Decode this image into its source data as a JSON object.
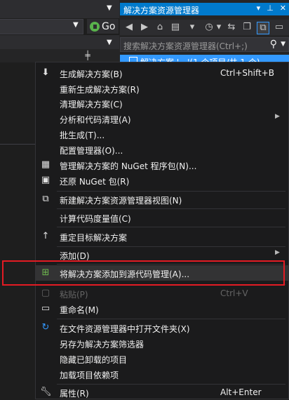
{
  "background": {
    "go_button_label": "Go"
  },
  "solution_explorer": {
    "title": "解决方案资源管理器",
    "title_controls": [
      "▾",
      "⊥",
      "✕"
    ],
    "search_placeholder": "搜索解决方案资源管理器(Ctrl+;)",
    "tree_selected_item": "解决方案 '…'(1 个项目/共 1 个)"
  },
  "context_menu": {
    "items": [
      {
        "icon": "build-solution-icon",
        "label": "生成解决方案(B)",
        "shortcut": "Ctrl+Shift+B"
      },
      {
        "label": "重新生成解决方案(R)"
      },
      {
        "label": "清理解决方案(C)"
      },
      {
        "label": "分析和代码清理(A)",
        "submenu": true
      },
      {
        "label": "批生成(T)..."
      },
      {
        "label": "配置管理器(O)..."
      },
      {
        "icon": "nuget-package-icon",
        "label": "管理解决方案的 NuGet 程序包(N)..."
      },
      {
        "icon": "restore-nuget-icon",
        "label": "还原 NuGet 包(R)"
      },
      {
        "icon": "new-view-icon",
        "label": "新建解决方案资源管理器视图(N)"
      },
      {
        "label": "计算代码度量值(C)"
      },
      {
        "icon": "retarget-icon",
        "label": "重定目标解决方案"
      },
      {
        "label": "添加(D)",
        "submenu": true
      },
      {
        "icon": "add-source-control-icon",
        "label": "将解决方案添加到源代码管理(A)..."
      },
      {
        "icon": "paste-icon",
        "label": "粘贴(P)",
        "shortcut": "Ctrl+V",
        "disabled": true
      },
      {
        "icon": "rename-icon",
        "label": "重命名(M)"
      },
      {
        "icon": "open-folder-icon",
        "label": "在文件资源管理器中打开文件夹(X)"
      },
      {
        "label": "另存为解决方案筛选器"
      },
      {
        "label": "隐藏已卸载的项目"
      },
      {
        "label": "加载项目依赖项"
      },
      {
        "icon": "properties-icon",
        "label": "属性(R)",
        "shortcut": "Alt+Enter"
      }
    ]
  },
  "colors": {
    "accent": "#007acc",
    "highlight_box": "#e31b23",
    "menu_background": "#1b1b1c"
  }
}
